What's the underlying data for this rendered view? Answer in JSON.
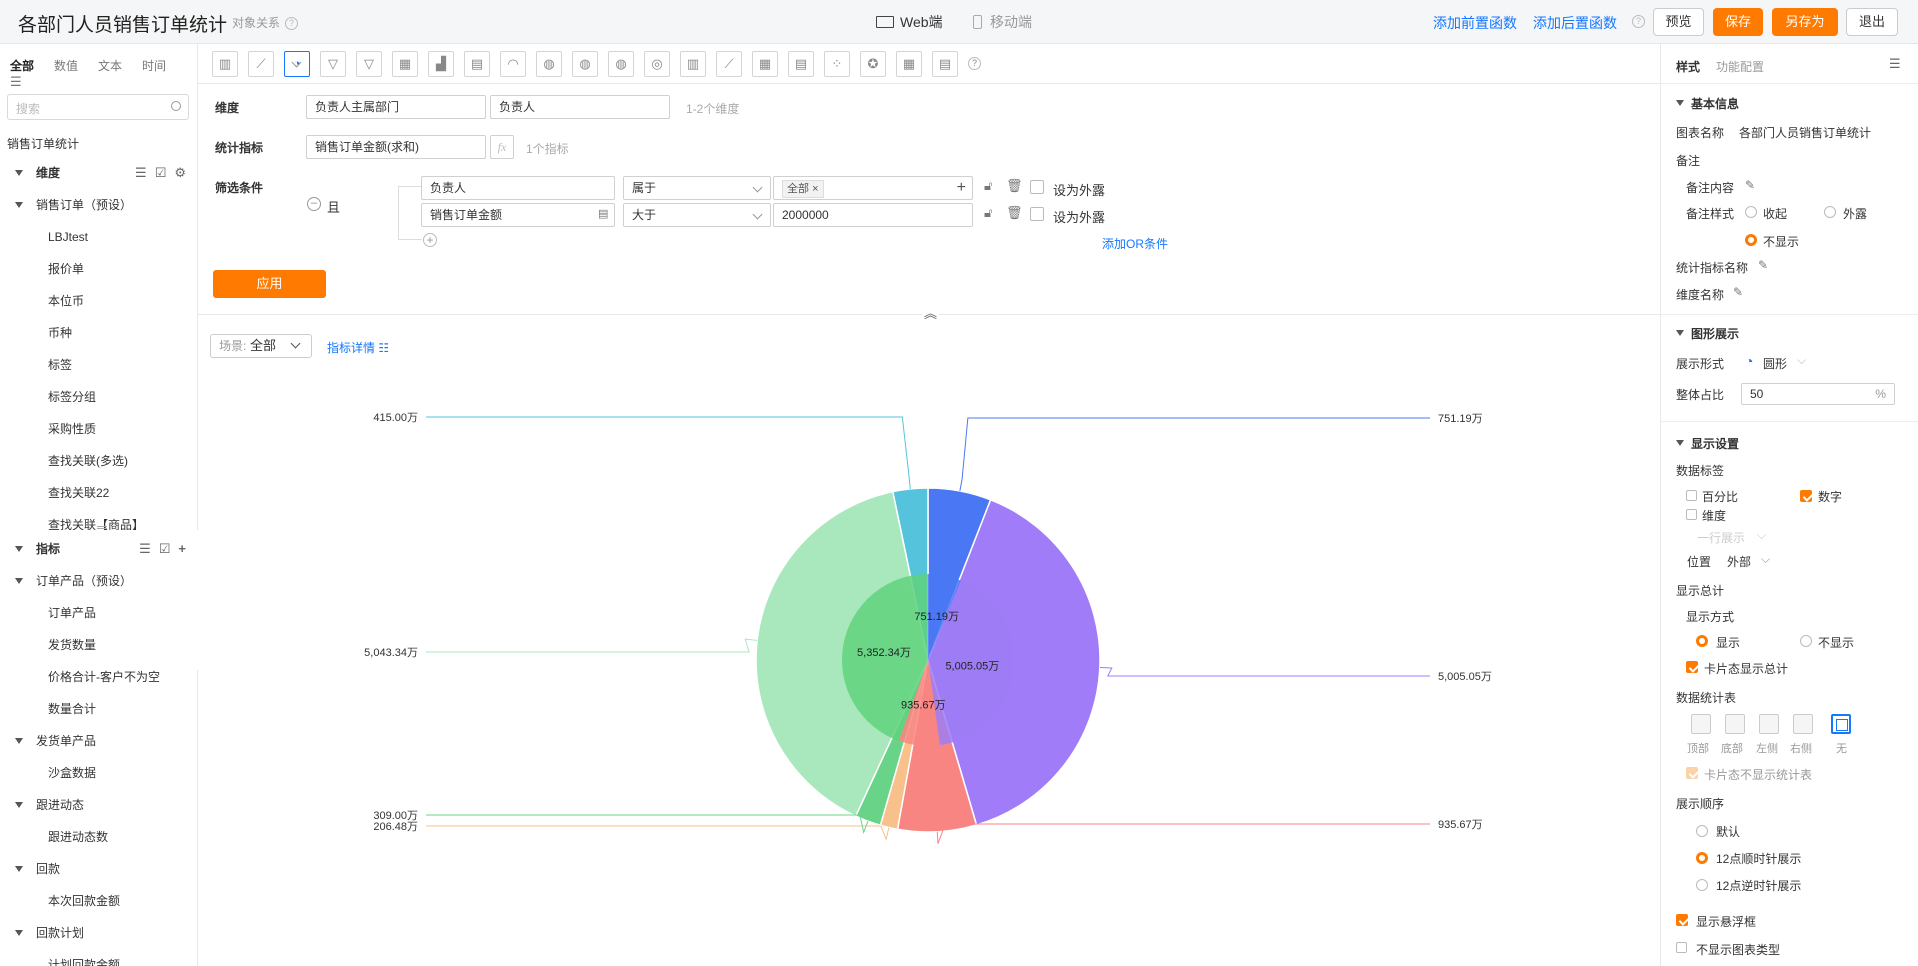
{
  "header": {
    "title": "各部门人员销售订单统计",
    "relation": "对象关系",
    "tab_web": "Web端",
    "tab_mobile": "移动端",
    "link_pre": "添加前置函数",
    "link_post": "添加后置函数",
    "btn_preview": "预览",
    "btn_save": "保存",
    "btn_saveas": "另存为",
    "btn_exit": "退出"
  },
  "left": {
    "tabs": [
      "全部",
      "数值",
      "文本",
      "时间"
    ],
    "search_placeholder": "搜索",
    "root": "销售订单统计",
    "dim_head": "维度",
    "dim_group": "销售订单（预设）",
    "dim_items": [
      "LBJtest",
      "报价单",
      "本位币",
      "币种",
      "标签",
      "标签分组",
      "采购性质",
      "查找关联(多选)",
      "查找关联22",
      "查找关联【商品】"
    ],
    "metric_head": "指标",
    "metric_tree": [
      {
        "type": "group",
        "label": "订单产品（预设）"
      },
      {
        "type": "item",
        "label": "订单产品"
      },
      {
        "type": "item",
        "label": "发货数量"
      },
      {
        "type": "item",
        "label": "价格合计-客户不为空"
      },
      {
        "type": "item",
        "label": "数量合计"
      },
      {
        "type": "group",
        "label": "发货单产品"
      },
      {
        "type": "item",
        "label": "沙盒数据"
      },
      {
        "type": "group",
        "label": "跟进动态"
      },
      {
        "type": "item",
        "label": "跟进动态数"
      },
      {
        "type": "group",
        "label": "回款"
      },
      {
        "type": "item",
        "label": "本次回款金额"
      },
      {
        "type": "group",
        "label": "回款计划"
      },
      {
        "type": "item",
        "label": "计划回款金额"
      }
    ]
  },
  "toolbar": {
    "icons": [
      "bar-chart-icon",
      "line-chart-icon",
      "pie-chart-icon",
      "funnel-icon",
      "funnel-alt-icon",
      "table-icon",
      "combo-chart-icon",
      "card-icon",
      "gauge-icon",
      "map-icon",
      "map-bubble-icon",
      "map-heat-icon",
      "target-icon",
      "stacked-bar-icon",
      "area-chart-icon",
      "pivot-icon",
      "pivot-table-icon",
      "scatter-icon",
      "radar-icon",
      "grid-icon",
      "tree-table-icon",
      "help-icon"
    ],
    "selected": 2
  },
  "config": {
    "dim_label": "维度",
    "dim_values": [
      "负责人主属部门",
      "负责人"
    ],
    "dim_hint": "1-2个维度",
    "metric_label": "统计指标",
    "metric_value": "销售订单金额(求和)",
    "fx": "fx",
    "metric_hint": "1个指标",
    "filter_label": "筛选条件",
    "and_label": "且",
    "filters": [
      {
        "field": "负责人",
        "op": "属于",
        "value_tag": "全部",
        "expose": "设为外露"
      },
      {
        "field": "销售订单金额",
        "op": "大于",
        "value": "2000000",
        "expose": "设为外露"
      }
    ],
    "add_or": "添加OR条件",
    "apply": "应用"
  },
  "scene": {
    "label": "场景:",
    "value": "全部",
    "detail": "指标详情"
  },
  "chart_data": {
    "type": "pie",
    "subtype": "nested-donut",
    "outer": [
      {
        "label": "751.19万",
        "value": 751.19,
        "color": "#4a78f5"
      },
      {
        "label": "5,005.05万",
        "value": 5005.05,
        "color": "#a07cf8"
      },
      {
        "label": "935.67万",
        "value": 935.67,
        "color": "#f98583"
      },
      {
        "label": "206.48万",
        "value": 206.48,
        "color": "#f8c08a"
      },
      {
        "label": "309.00万",
        "value": 309.0,
        "color": "#69d487"
      },
      {
        "label": "5,043.34万",
        "value": 5043.34,
        "color": "#a9e8bd"
      },
      {
        "label": "415.00万",
        "value": 415.0,
        "color": "#55c3dc"
      }
    ],
    "inner": [
      {
        "label": "751.19万",
        "value": 751.19,
        "color": "#4a78f5"
      },
      {
        "label": "5,005.05万",
        "value": 5005.05,
        "color": "#9d7cf6"
      },
      {
        "label": "935.67万",
        "value": 935.67,
        "color": "#f98583"
      },
      {
        "label": "5,352.34万",
        "value": 5352.34,
        "color": "#5fd27d"
      }
    ],
    "start": "12 o'clock",
    "direction": "clockwise",
    "ring_ratio": 50
  },
  "right": {
    "tab_style": "样式",
    "tab_func": "功能配置",
    "basic": "基本信息",
    "chart_name_label": "图表名称",
    "chart_name": "各部门人员销售订单统计",
    "remark": "备注",
    "remark_content": "备注内容",
    "remark_style": "备注样式",
    "collapse": "收起",
    "exposed": "外露",
    "hide": "不显示",
    "metric_name": "统计指标名称",
    "dim_name": "维度名称",
    "graph": "图形展示",
    "show_form": "展示形式",
    "form_value": "圆形",
    "ratio_label": "整体占比",
    "ratio_value": "50",
    "pct": "%",
    "display": "显示设置",
    "data_label": "数据标签",
    "percent": "百分比",
    "number": "数字",
    "dimension": "维度",
    "oneline": "一行展示",
    "position": "位置",
    "position_value": "外部",
    "total": "显示总计",
    "total_mode": "显示方式",
    "show": "显示",
    "not_show": "不显示",
    "card_total": "卡片态显示总计",
    "stats_table": "数据统计表",
    "positions": [
      "顶部",
      "底部",
      "左侧",
      "右侧",
      "无"
    ],
    "card_no_table": "卡片态不显示统计表",
    "order": "展示顺序",
    "order_default": "默认",
    "order_cw": "12点顺时针展示",
    "order_ccw": "12点逆时针展示",
    "tooltip": "显示悬浮框",
    "no_type": "不显示图表类型"
  }
}
